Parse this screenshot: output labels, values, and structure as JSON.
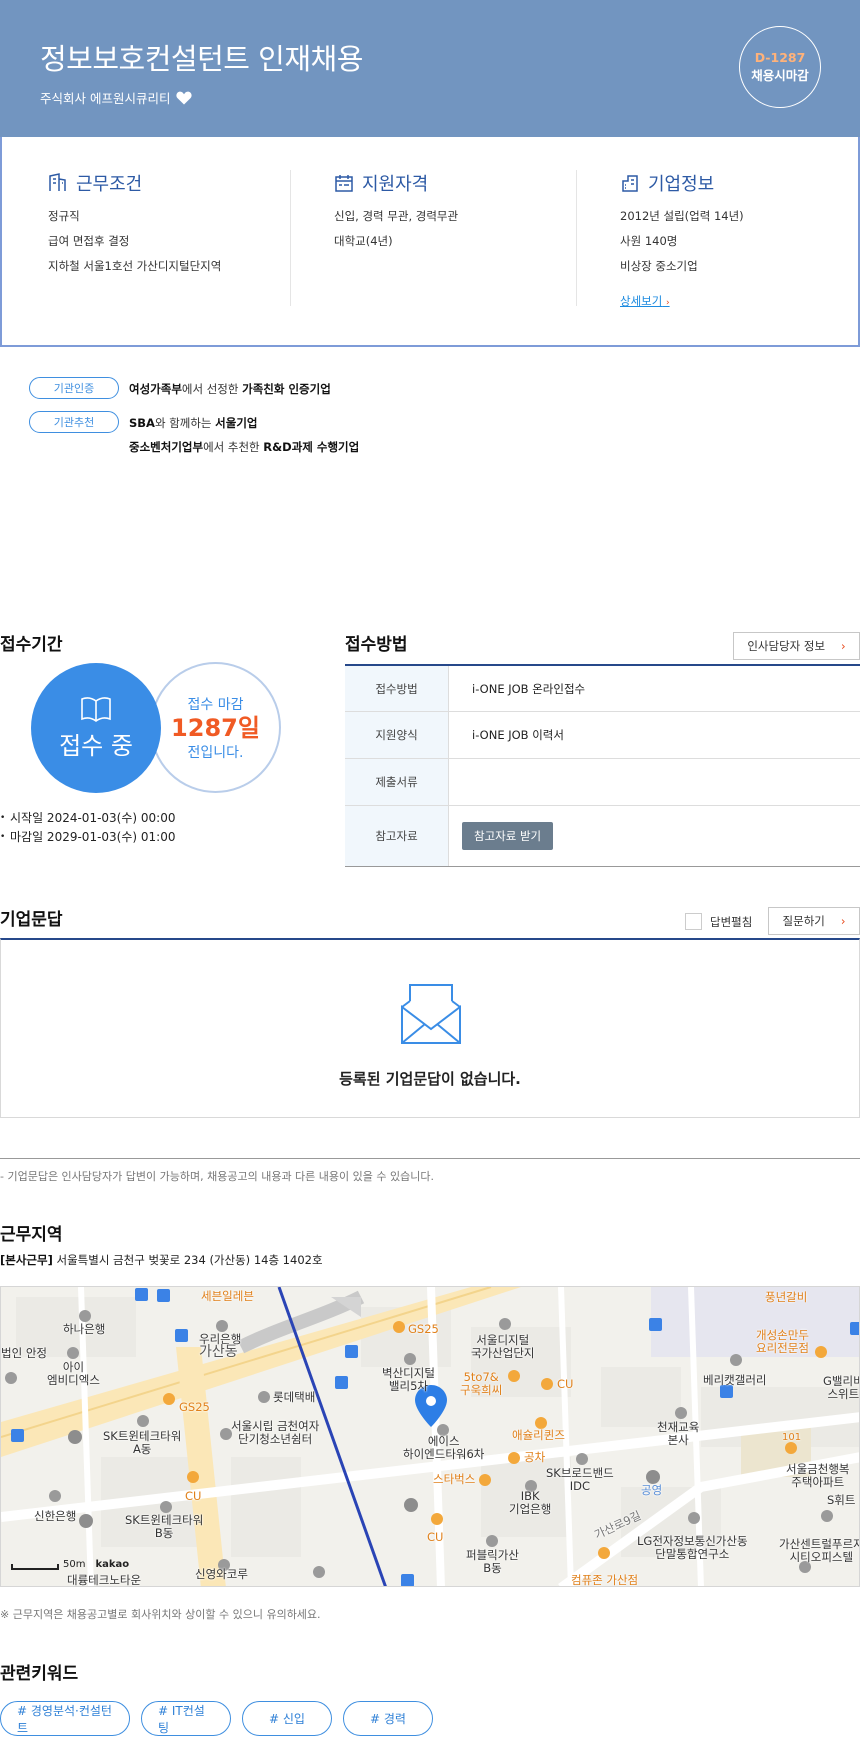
{
  "header": {
    "title": "정보보호컨설턴트 인재채용",
    "company": "주식회사 에프원시큐리티",
    "dday": "D-1287",
    "dday_label": "채용시마감"
  },
  "summary": {
    "work": {
      "title": "근무조건",
      "lines": [
        "정규직",
        "급여 면접후 결정",
        "지하철 서울1호선 가산디지털단지역"
      ]
    },
    "qualify": {
      "title": "지원자격",
      "lines": [
        "신입, 경력 무관, 경력무관",
        "대학교(4년)"
      ]
    },
    "company": {
      "title": "기업정보",
      "lines": [
        "2012년 설립(업력 14년)",
        "사원 140명",
        "비상장 중소기업"
      ],
      "more": "상세보기"
    }
  },
  "certs": [
    {
      "badge": "기관인증",
      "lines": [
        {
          "a": "여성가족부",
          "b": "에서 선정한 ",
          "c": "가족친화 인증기업"
        }
      ]
    },
    {
      "badge": "기관추천",
      "lines": [
        {
          "a": "SBA",
          "b": "와 함께하는 ",
          "c": "서울기업"
        },
        {
          "a": "중소벤처기업부",
          "b": "에서 추천한 ",
          "c": "R&D과제 수행기업"
        }
      ]
    }
  ],
  "period": {
    "title": "접수기간",
    "status": "접수 중",
    "deadline_label": "접수 마감",
    "deadline_days": "1287일",
    "deadline_suffix": "전입니다.",
    "start": "시작일 2024-01-03(수) 00:00",
    "end": "마감일 2029-01-03(수) 01:00"
  },
  "method": {
    "title": "접수방법",
    "hr_button": "인사담당자 정보",
    "rows": [
      {
        "key": "접수방법",
        "value": "i-ONE JOB 온라인접수"
      },
      {
        "key": "지원양식",
        "value": "i-ONE JOB 이력서"
      },
      {
        "key": "제출서류",
        "value": ""
      },
      {
        "key": "참고자료",
        "button": "참고자료 받기"
      }
    ]
  },
  "qa": {
    "title": "기업문답",
    "checkbox_label": "답변펼침",
    "ask_button": "질문하기",
    "empty": "등록된 기업문답이 없습니다.",
    "note": "- 기업문답은 인사담당자가 답변이 가능하며, 채용공고의 내용과 다른 내용이 있을 수 있습니다."
  },
  "location": {
    "title": "근무지역",
    "tag": "[본사근무]",
    "address": " 서울특별시 금천구 벚꽃로 234 (가산동) 14층 1402호",
    "note": "※ 근무지역은 채용공고별로 회사위치와 상이할 수 있으니 유의하세요.",
    "map_labels": {
      "seven": "세븐일레븐",
      "hana": "하나은행",
      "woori": "우리은행",
      "gasan": "가산동",
      "corp": "법인 안정",
      "aiemb": "아이\n엠비디엑스",
      "lotte": "롯데택배",
      "gs25a": "GS25",
      "gs25b": "GS25",
      "sk1": "SK트윈테크타워\nA동",
      "seoulcity": "서울시립 금천여자\n단기청소년쉼터",
      "cu1": "CU",
      "sk2": "SK트윈테크타워\nB동",
      "shinhan": "신한은행",
      "daeryung": "대륭테크노타운",
      "shinyoung": "신영와코루",
      "byuksan": "벽산디지털\n밸리5차",
      "sdigital": "서울디지털\n국가산업단지",
      "fiveto7": "5to7&\n구욱희씨",
      "cu2": "CU",
      "ace": "에이스\n하이엔드타워6차",
      "aesh": "애슐리퀸즈",
      "gongcha": "공차",
      "starbucks": "스타벅스",
      "ibk": "IBK\n기업은행",
      "skb": "SK브로드밴드\nIDC",
      "cu3": "CU",
      "public": "퍼블릭가산\nB동",
      "gasan9": "가산로9길",
      "compose": "컴퓨존 가산점",
      "park": "공영",
      "lg": "LG전자정보통신가산동\n단말통합연구소",
      "chunjae": "천재교육\n본사",
      "verica": "베리캣갤러리",
      "pung": "풍년갈비",
      "gaesung": "개성손만두\n요리전문점",
      "gval": "G밸리비\n스위트",
      "seoulgeum": "서울금천행복\n주택아파트",
      "apt101": "101",
      "gasancent": "가산센트럴푸르지\n시티오피스텔",
      "shwi": "S휘트",
      "scale": "50m",
      "kakao": "kakao"
    }
  },
  "keywords": {
    "title": "관련키워드",
    "items": [
      "# 경영분석·컨설턴트",
      "# IT컨설팅",
      "# 신입",
      "# 경력"
    ]
  },
  "colors": {
    "hero": "#7295c0",
    "primary": "#3a8de6",
    "accent": "#f05a24",
    "navy": "#26488a"
  }
}
